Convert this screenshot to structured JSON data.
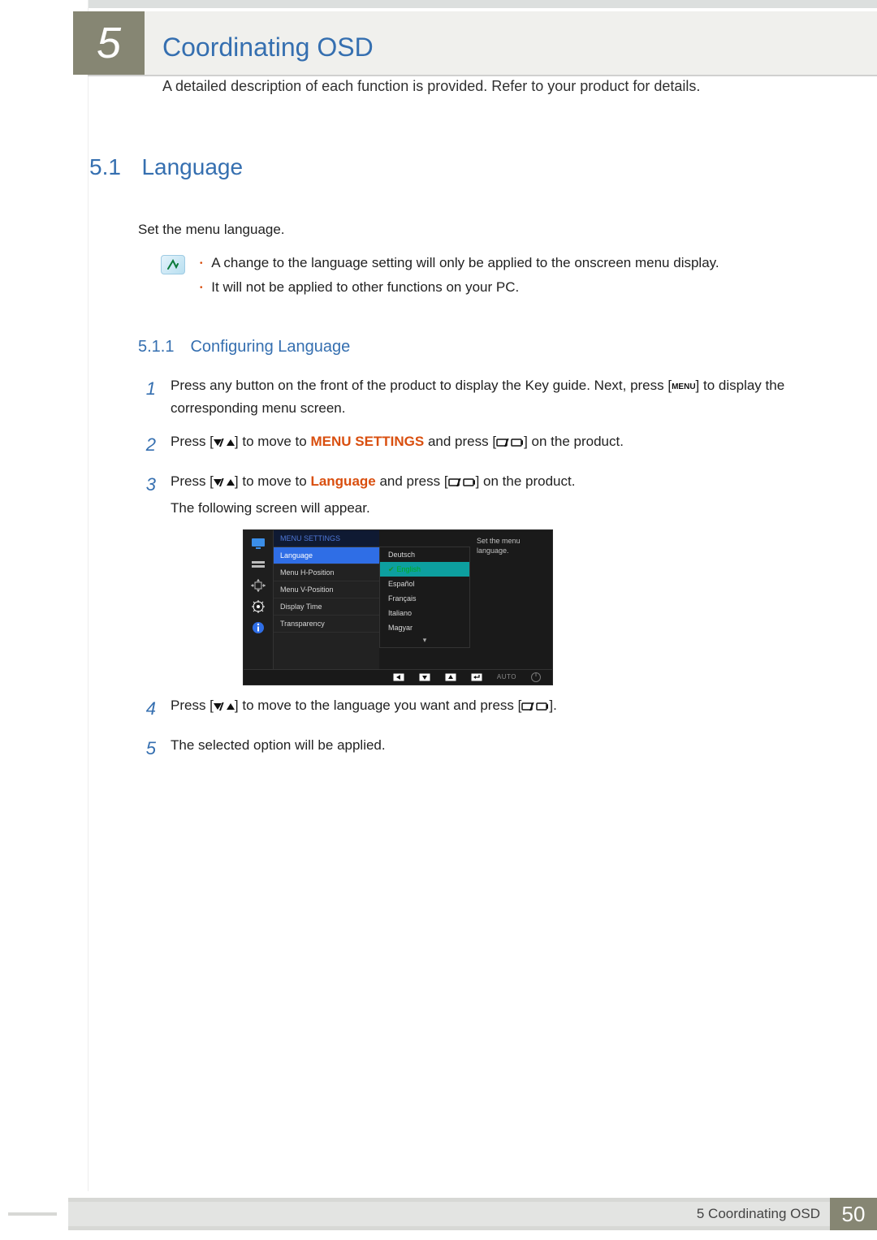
{
  "chapter": {
    "number_label": "5",
    "title": "Coordinating OSD",
    "subtitle": "A detailed description of each function is provided. Refer to your product for details."
  },
  "section": {
    "number": "5.1",
    "title": "Language",
    "intro": "Set the menu language.",
    "notes": [
      "A change to the language setting will only be applied to the onscreen menu display.",
      "It will not be applied to other functions on your PC."
    ]
  },
  "subsection": {
    "number": "5.1.1",
    "title": "Configuring Language"
  },
  "steps": {
    "s1_pre": "Press any button on the front of the product to display the Key guide. Next, press [",
    "s1_key": "MENU",
    "s1_post": "] to display the corresponding menu screen.",
    "s2_pre": "Press [",
    "s2_mid": "] to move to ",
    "s2_kw": "MENU SETTINGS",
    "s2_post1": " and press [",
    "s2_post2": "] on the product.",
    "s3_pre": "Press [",
    "s3_mid": "] to move to ",
    "s3_kw": "Language",
    "s3_post1": " and press [",
    "s3_post2": "] on the product.",
    "s3_tail": "The following screen will appear.",
    "s4_pre": "Press [",
    "s4_mid": "] to move to the language you want and press [",
    "s4_post": "].",
    "s5": "The selected option will be applied."
  },
  "step_numbers": {
    "n1": "1",
    "n2": "2",
    "n3": "3",
    "n4": "4",
    "n5": "5"
  },
  "osd": {
    "header": "MENU SETTINGS",
    "menu_items": [
      "Language",
      "Menu H-Position",
      "Menu V-Position",
      "Display Time",
      "Transparency"
    ],
    "languages": [
      "Deutsch",
      "English",
      "Español",
      "Français",
      "Italiano",
      "Magyar"
    ],
    "help_line1": "Set the menu",
    "help_line2": "language.",
    "bar_auto": "AUTO"
  },
  "footer": {
    "title": "5 Coordinating OSD",
    "page": "50"
  }
}
